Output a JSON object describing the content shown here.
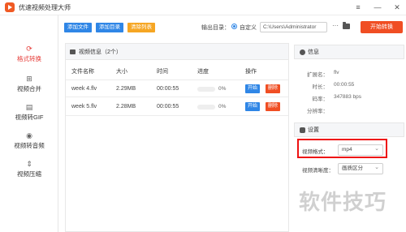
{
  "window": {
    "title": "优速视频处理大师",
    "controls": [
      "≡",
      "—",
      "✕"
    ]
  },
  "sidebar": {
    "items": [
      {
        "label": "格式转换",
        "icon": "format-convert-icon",
        "active": true
      },
      {
        "label": "视频合并",
        "icon": "video-merge-icon",
        "active": false
      },
      {
        "label": "视频转GIF",
        "icon": "gif-icon",
        "active": false
      },
      {
        "label": "视频转音频",
        "icon": "audio-icon",
        "active": false
      },
      {
        "label": "视频压缩",
        "icon": "compress-icon",
        "active": false
      }
    ]
  },
  "toolbar": {
    "add_file": "添加文件",
    "add_folder": "添加目录",
    "clear_list": "清除列表",
    "output_label": "输出目录：",
    "custom_label": "自定义",
    "output_path": "C:\\Users\\Administrator",
    "start_button": "开始转换"
  },
  "file_panel": {
    "title": "视频信息（2个）",
    "columns": [
      "文件名称",
      "大小",
      "时间",
      "进度",
      "操作"
    ],
    "rows": [
      {
        "name": "week 4.flv",
        "size": "2.29MB",
        "time": "00:00:55",
        "progress": "0%",
        "start": "开始",
        "delete": "删除"
      },
      {
        "name": "week 5.flv",
        "size": "2.28MB",
        "time": "00:00:55",
        "progress": "0%",
        "start": "开始",
        "delete": "删除"
      }
    ]
  },
  "info_panel": {
    "title": "信息",
    "fields": [
      {
        "key": "扩展名：",
        "value": "flv"
      },
      {
        "key": "时长：",
        "value": "00:00:55"
      },
      {
        "key": "码率：",
        "value": "347883 bps"
      },
      {
        "key": "分辨率：",
        "value": ""
      }
    ]
  },
  "settings_panel": {
    "title": "设置",
    "format_label": "视频格式：",
    "format_value": "mp4",
    "quality_label": "视频清晰度：",
    "quality_value": "画质区分"
  },
  "watermark": "软件技巧",
  "colors": {
    "accent_red": "#f04e23",
    "accent_blue": "#2f86e6",
    "accent_orange": "#f6a623"
  }
}
